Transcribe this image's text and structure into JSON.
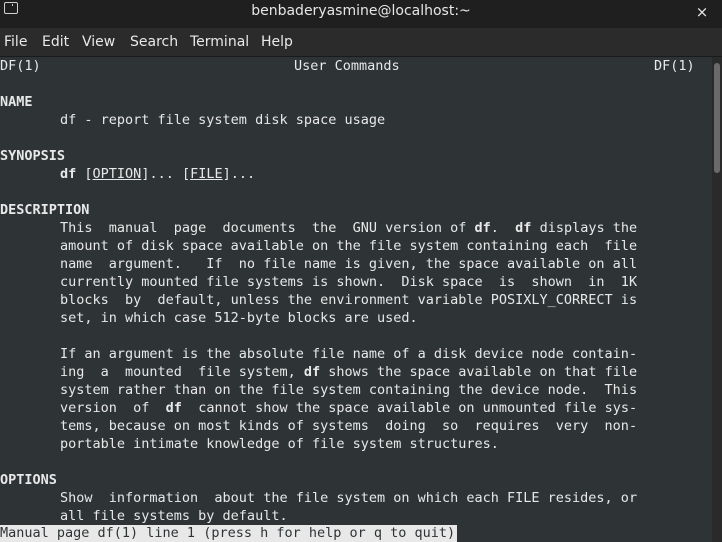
{
  "window": {
    "title": "benbaderyasmine@localhost:~",
    "close_icon": "×"
  },
  "menu": [
    "File",
    "Edit",
    "View",
    "Search",
    "Terminal",
    "Help"
  ],
  "header": {
    "left": "DF(1)",
    "center": "User Commands",
    "right": "DF(1)"
  },
  "name_section": {
    "heading": "NAME",
    "text": "df - report file system disk space usage"
  },
  "synopsis_section": {
    "heading": "SYNOPSIS",
    "cmd": "df",
    "sp": " ",
    "option": "OPTION",
    "dots": "]... [",
    "file": "FILE",
    "end": "]...",
    "open": "["
  },
  "description_section": {
    "heading": "DESCRIPTION",
    "p1_l1a": "This  manual  page  documents  the  GNU version of ",
    "p1_l1b": "df",
    "p1_l1c": ".  ",
    "p1_l1d": "df",
    "p1_l1e": " displays the",
    "p1_l2": "amount of disk space available on the file system containing each  file",
    "p1_l3": "name  argument.   If  no file name is given, the space available on all",
    "p1_l4": "currently mounted file systems is shown.  Disk space  is  shown  in  1K",
    "p1_l5": "blocks  by  default, unless the environment variable POSIXLY_CORRECT is",
    "p1_l6": "set, in which case 512-byte blocks are used.",
    "p2_l1": "If an argument is the absolute file name of a disk device node contain-",
    "p2_l2a": "ing  a  mounted  file system, ",
    "p2_l2b": "df",
    "p2_l2c": " shows the space available on that file",
    "p2_l3": "system rather than on the file system containing the device node.  This",
    "p2_l4a": "version  of  ",
    "p2_l4b": "df",
    "p2_l4c": "  cannot show the space available on unmounted file sys-",
    "p2_l5": "tems, because on most kinds of systems  doing  so  requires  very  non-",
    "p2_l6": "portable intimate knowledge of file system structures."
  },
  "options_section": {
    "heading": "OPTIONS",
    "l1": "Show  information  about the file system on which each FILE resides, or",
    "l2": "all file systems by default."
  },
  "status_line": "Manual page df(1) line 1 (press h for help or q to quit)"
}
